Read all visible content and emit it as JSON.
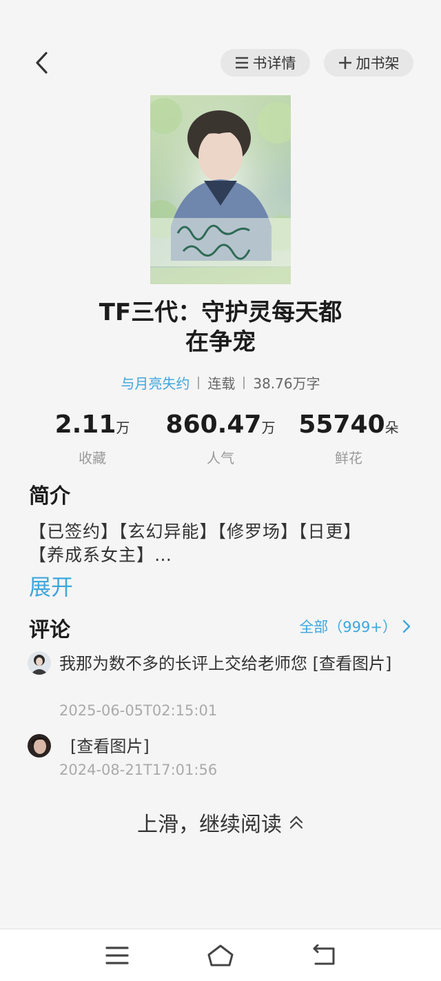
{
  "header": {
    "detail_label": "书详情",
    "shelf_label": "加书架"
  },
  "book": {
    "title_line1": "TF三代：守护灵每天都",
    "title_line2": "在争宠",
    "author": "与月亮失约",
    "status": "连载",
    "word_count": "38.76万字"
  },
  "stats": [
    {
      "value": "2.11",
      "unit": "万",
      "label": "收藏"
    },
    {
      "value": "860.47",
      "unit": "万",
      "label": "人气"
    },
    {
      "value": "55740",
      "unit": "朵",
      "label": "鲜花"
    }
  ],
  "intro": {
    "heading": "简介",
    "line1": "【已签约】【玄幻异能】【修罗场】【日更】",
    "line2": "【养成系女主】…",
    "expand_label": "展开"
  },
  "comments": {
    "heading": "评论",
    "all_label": "全部（999+）",
    "items": [
      {
        "text": "我那为数不多的长评上交给老师您  [查看图片]",
        "time": "2025-06-05T02:15:01"
      },
      {
        "text": "[查看图片]",
        "time": "2024-08-21T17:01:56"
      }
    ]
  },
  "continue_label": "上滑，继续阅读",
  "icons": {
    "back": "chevron-left-icon",
    "detail": "list-icon",
    "shelf": "plus-icon",
    "all_comments": "chevron-right-icon",
    "continue": "double-chevron-up-icon",
    "nav_menu": "menu-icon",
    "nav_home": "home-icon",
    "nav_back": "return-icon"
  },
  "colors": {
    "accent": "#3fa6de",
    "background": "#f5f5f5",
    "pill": "#e7e7e7"
  }
}
